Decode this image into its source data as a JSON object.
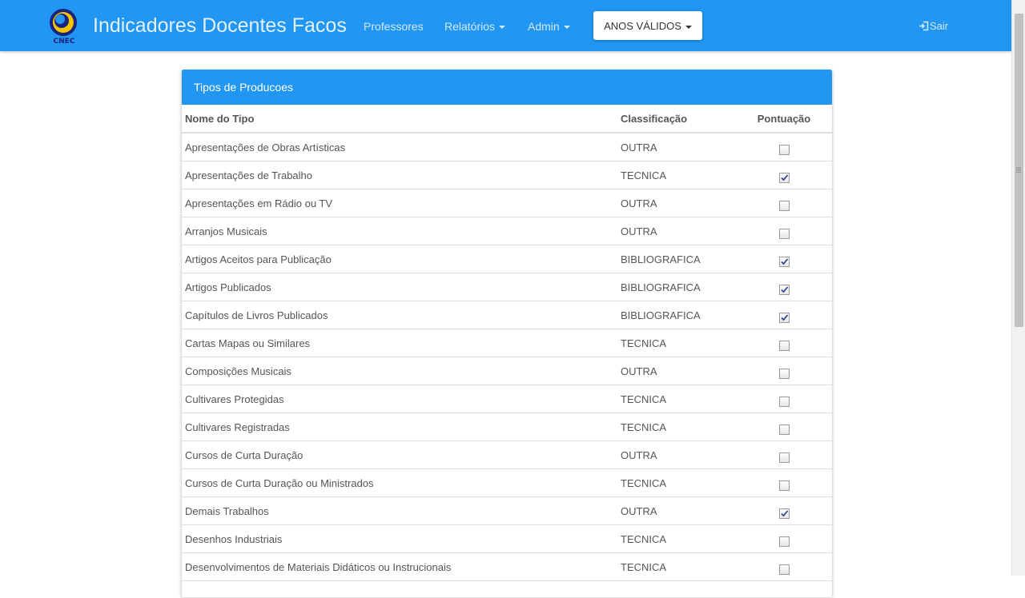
{
  "header": {
    "logo_text": "CNEC",
    "brand": "Indicadores Docentes Facos",
    "nav": {
      "professores": "Professores",
      "relatorios": "Relatórios",
      "admin": "Admin"
    },
    "years_button": "ANOS VÁLIDOS",
    "logout": "Sair",
    "logout_icon": "sign-out-icon",
    "accent_color": "#2196f3"
  },
  "panel": {
    "title": "Tipos de Producoes",
    "columns": {
      "name": "Nome do Tipo",
      "classification": "Classificação",
      "score": "Pontuação"
    },
    "rows": [
      {
        "name": "Apresentações de Obras Artísticas",
        "classification": "OUTRA",
        "checked": false
      },
      {
        "name": "Apresentações de Trabalho",
        "classification": "TECNICA",
        "checked": true
      },
      {
        "name": "Apresentações em Rádio ou TV",
        "classification": "OUTRA",
        "checked": false
      },
      {
        "name": "Arranjos Musicais",
        "classification": "OUTRA",
        "checked": false
      },
      {
        "name": "Artigos Aceitos para Publicação",
        "classification": "BIBLIOGRAFICA",
        "checked": true
      },
      {
        "name": "Artigos Publicados",
        "classification": "BIBLIOGRAFICA",
        "checked": true
      },
      {
        "name": "Capítulos de Livros Publicados",
        "classification": "BIBLIOGRAFICA",
        "checked": true
      },
      {
        "name": "Cartas Mapas ou Similares",
        "classification": "TECNICA",
        "checked": false
      },
      {
        "name": "Composições Musicais",
        "classification": "OUTRA",
        "checked": false
      },
      {
        "name": "Cultivares Protegidas",
        "classification": "TECNICA",
        "checked": false
      },
      {
        "name": "Cultivares Registradas",
        "classification": "TECNICA",
        "checked": false
      },
      {
        "name": "Cursos de Curta Duração",
        "classification": "OUTRA",
        "checked": false
      },
      {
        "name": "Cursos de Curta Duração ou Ministrados",
        "classification": "TECNICA",
        "checked": false
      },
      {
        "name": "Demais Trabalhos",
        "classification": "OUTRA",
        "checked": true
      },
      {
        "name": "Desenhos Industriais",
        "classification": "TECNICA",
        "checked": false
      },
      {
        "name": "Desenvolvimentos de Materiais Didáticos ou Instrucionais",
        "classification": "TECNICA",
        "checked": false
      }
    ]
  }
}
